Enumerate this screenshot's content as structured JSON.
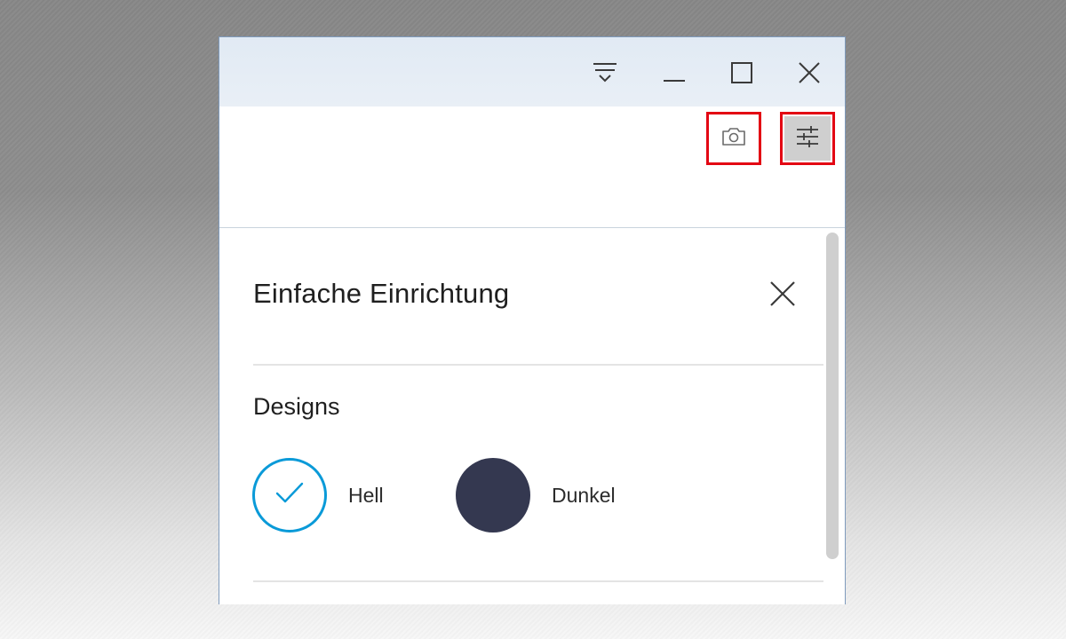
{
  "titlebar": {
    "icons": [
      "filter-icon",
      "minimize-icon",
      "maximize-icon",
      "close-icon"
    ]
  },
  "toolbar": {
    "icons": [
      "camera-icon",
      "settings-sliders-icon"
    ],
    "highlight_color": "#e30613"
  },
  "panel": {
    "title": "Einfache Einrichtung",
    "close_icon": "close-icon",
    "designs": {
      "heading": "Designs",
      "options": [
        {
          "label": "Hell",
          "selected": true,
          "color": "#ffffff",
          "accent": "#0a9ad8",
          "icon": "checkmark-icon"
        },
        {
          "label": "Dunkel",
          "selected": false,
          "color": "#343850"
        }
      ]
    }
  }
}
